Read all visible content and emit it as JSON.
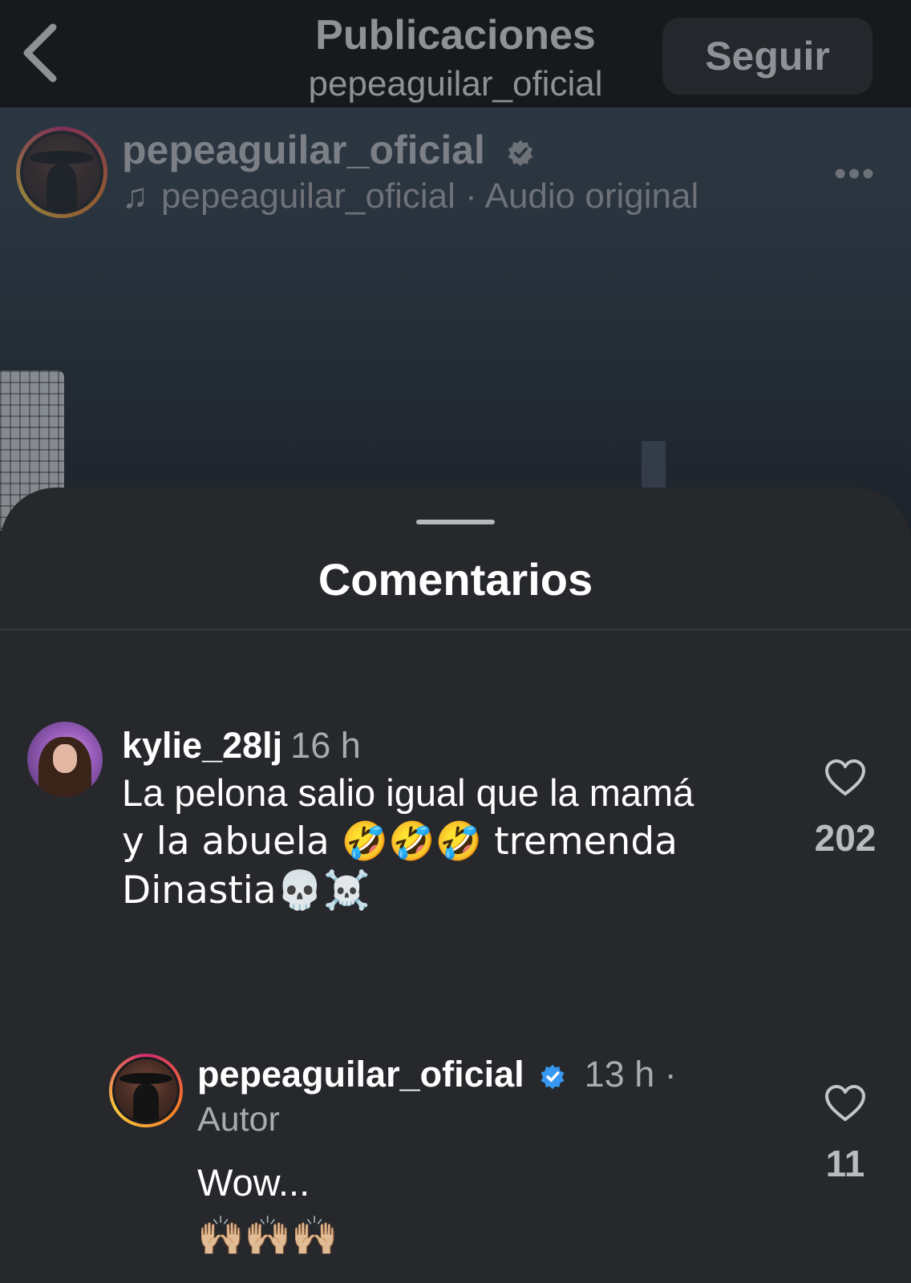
{
  "nav": {
    "title": "Publicaciones",
    "subtitle": "pepeaguilar_oficial",
    "follow_label": "Seguir"
  },
  "post": {
    "username": "pepeaguilar_oficial",
    "audio_note_icon": "♫",
    "audio_label": "pepeaguilar_oficial · Audio original",
    "more_label": "•••"
  },
  "comments_sheet": {
    "title": "Comentarios",
    "comments": [
      {
        "username": "kylie_28lj",
        "time": "16 h",
        "text_line1": "La pelona salio igual que la mamá",
        "text_line2": "y la abuela 🤣🤣🤣 tremenda",
        "text_line3": "Dinastia💀☠️",
        "likes": "202"
      }
    ],
    "replies": [
      {
        "username": "pepeaguilar_oficial",
        "time": "13 h ·",
        "author_label": "Autor",
        "text_line1": "Wow...",
        "text_line2": "🙌🏼🙌🏼🙌🏼",
        "likes": "11"
      }
    ]
  },
  "colors": {
    "verified_blue": "#3897f0",
    "story_ring_start": "#d22b6c",
    "story_ring_end": "#f9c83c"
  },
  "icons": {
    "back": "chevron-left-icon",
    "verified": "verified-badge-icon",
    "like": "heart-outline-icon",
    "more": "more-horizontal-icon",
    "music": "music-note-icon"
  }
}
